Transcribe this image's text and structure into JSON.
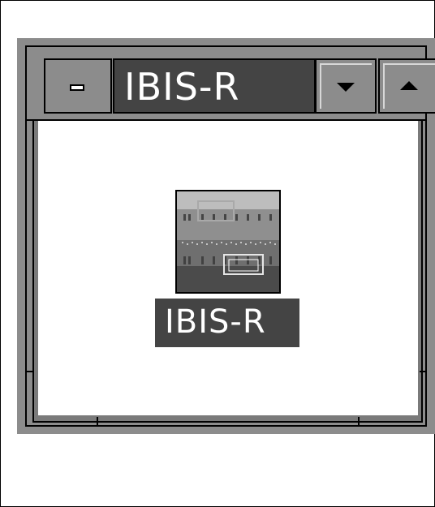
{
  "window": {
    "title": "IBIS-R",
    "controls": {
      "system_menu_icon": "window-menu-icon",
      "minimize_icon": "minimize-arrow-icon",
      "maximize_icon": "maximize-arrow-icon"
    }
  },
  "desktop_icon": {
    "label": "IBIS-R",
    "icon": "ibis-r-app-icon"
  },
  "colors": {
    "frame": "#8c8c8c",
    "title_background": "#444444",
    "client_background": "#ffffff",
    "text": "#ffffff"
  }
}
